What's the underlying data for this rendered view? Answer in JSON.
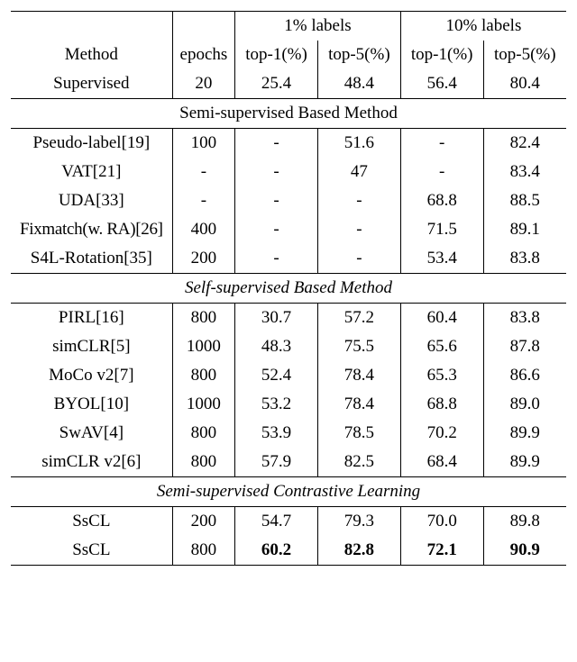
{
  "header": {
    "method_label": "Method",
    "epochs_label": "epochs",
    "group1": "1% labels",
    "group2": "10% labels",
    "top1": "top-1(%)",
    "top5": "top-5(%)",
    "supervised_label": "Supervised",
    "supervised_epochs": "20",
    "supervised_1_top1": "25.4",
    "supervised_1_top5": "48.4",
    "supervised_10_top1": "56.4",
    "supervised_10_top5": "80.4"
  },
  "sec1": {
    "title": "Semi-supervised Based Method",
    "rows": [
      {
        "m": "Pseudo-label[19]",
        "e": "100",
        "a": "-",
        "b": "51.6",
        "c": "-",
        "d": "82.4"
      },
      {
        "m": "VAT[21]",
        "e": "-",
        "a": "-",
        "b": "47",
        "c": "-",
        "d": "83.4"
      },
      {
        "m": "UDA[33]",
        "e": "-",
        "a": "-",
        "b": "-",
        "c": "68.8",
        "d": "88.5"
      },
      {
        "m": "Fixmatch(w. RA)[26]",
        "e": "400",
        "a": "-",
        "b": "-",
        "c": "71.5",
        "d": "89.1"
      },
      {
        "m": "S4L-Rotation[35]",
        "e": "200",
        "a": "-",
        "b": "-",
        "c": "53.4",
        "d": "83.8"
      }
    ]
  },
  "sec2": {
    "title": "Self-supervised Based Method",
    "rows": [
      {
        "m": "PIRL[16]",
        "e": "800",
        "a": "30.7",
        "b": "57.2",
        "c": "60.4",
        "d": "83.8"
      },
      {
        "m": "simCLR[5]",
        "e": "1000",
        "a": "48.3",
        "b": "75.5",
        "c": "65.6",
        "d": "87.8"
      },
      {
        "m": "MoCo v2[7]",
        "e": "800",
        "a": "52.4",
        "b": "78.4",
        "c": "65.3",
        "d": "86.6"
      },
      {
        "m": "BYOL[10]",
        "e": "1000",
        "a": "53.2",
        "b": "78.4",
        "c": "68.8",
        "d": "89.0"
      },
      {
        "m": "SwAV[4]",
        "e": "800",
        "a": "53.9",
        "b": "78.5",
        "c": "70.2",
        "d": "89.9"
      },
      {
        "m": "simCLR v2[6]",
        "e": "800",
        "a": "57.9",
        "b": "82.5",
        "c": "68.4",
        "d": "89.9"
      }
    ]
  },
  "sec3": {
    "title": "Semi-supervised Contrastive Learning",
    "rows": [
      {
        "m": "SsCL",
        "e": "200",
        "a": "54.7",
        "b": "79.3",
        "c": "70.0",
        "d": "89.8",
        "bold": false
      },
      {
        "m": "SsCL",
        "e": "800",
        "a": "60.2",
        "b": "82.8",
        "c": "72.1",
        "d": "90.9",
        "bold": true
      }
    ]
  },
  "chart_data": {
    "type": "table",
    "title": "Semi-supervised comparison under 1% and 10% labels",
    "columns": [
      "Method",
      "epochs",
      "1% top-1(%)",
      "1% top-5(%)",
      "10% top-1(%)",
      "10% top-5(%)"
    ],
    "sections": [
      {
        "name": "Supervised",
        "rows": [
          [
            "Supervised",
            20,
            25.4,
            48.4,
            56.4,
            80.4
          ]
        ]
      },
      {
        "name": "Semi-supervised Based Method",
        "rows": [
          [
            "Pseudo-label[19]",
            100,
            null,
            51.6,
            null,
            82.4
          ],
          [
            "VAT[21]",
            null,
            null,
            47,
            null,
            83.4
          ],
          [
            "UDA[33]",
            null,
            null,
            null,
            68.8,
            88.5
          ],
          [
            "Fixmatch(w. RA)[26]",
            400,
            null,
            null,
            71.5,
            89.1
          ],
          [
            "S4L-Rotation[35]",
            200,
            null,
            null,
            53.4,
            83.8
          ]
        ]
      },
      {
        "name": "Self-supervised Based Method",
        "rows": [
          [
            "PIRL[16]",
            800,
            30.7,
            57.2,
            60.4,
            83.8
          ],
          [
            "simCLR[5]",
            1000,
            48.3,
            75.5,
            65.6,
            87.8
          ],
          [
            "MoCo v2[7]",
            800,
            52.4,
            78.4,
            65.3,
            86.6
          ],
          [
            "BYOL[10]",
            1000,
            53.2,
            78.4,
            68.8,
            89.0
          ],
          [
            "SwAV[4]",
            800,
            53.9,
            78.5,
            70.2,
            89.9
          ],
          [
            "simCLR v2[6]",
            800,
            57.9,
            82.5,
            68.4,
            89.9
          ]
        ]
      },
      {
        "name": "Semi-supervised Contrastive Learning",
        "rows": [
          [
            "SsCL",
            200,
            54.7,
            79.3,
            70.0,
            89.8
          ],
          [
            "SsCL",
            800,
            60.2,
            82.8,
            72.1,
            90.9
          ]
        ]
      }
    ]
  }
}
